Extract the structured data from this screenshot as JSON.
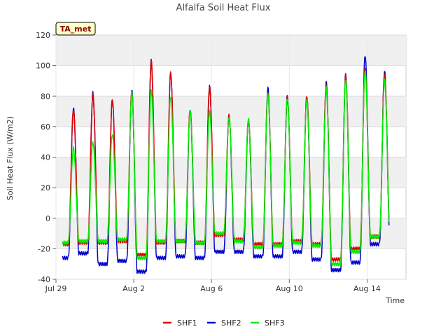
{
  "chart_data": {
    "type": "line",
    "title": "Alfalfa Soil Heat Flux",
    "xlabel": "Time",
    "ylabel": "Soil Heat Flux (W/m2)",
    "ylim": [
      -40,
      120
    ],
    "xlim": [
      "2023-07-29",
      "2023-08-16"
    ],
    "y_ticks": [
      "-40",
      "-20",
      "0",
      "20",
      "40",
      "60",
      "80",
      "100",
      "120"
    ],
    "x_ticks": [
      {
        "label": "Jul 29",
        "date": "2023-07-29"
      },
      {
        "label": "Aug 2",
        "date": "2023-08-02"
      },
      {
        "label": "Aug 6",
        "date": "2023-08-06"
      },
      {
        "label": "Aug 10",
        "date": "2023-08-10"
      },
      {
        "label": "Aug 14",
        "date": "2023-08-14"
      }
    ],
    "grid": true,
    "legend": "bottom",
    "badge": "TA_met",
    "days": [
      "2023-07-29",
      "2023-07-30",
      "2023-07-31",
      "2023-08-01",
      "2023-08-02",
      "2023-08-03",
      "2023-08-04",
      "2023-08-05",
      "2023-08-06",
      "2023-08-07",
      "2023-08-08",
      "2023-08-09",
      "2023-08-10",
      "2023-08-11",
      "2023-08-12",
      "2023-08-13",
      "2023-08-14",
      "2023-08-15"
    ],
    "series": [
      {
        "name": "SHF1",
        "color": "#dd0000",
        "daily_peak": [
          71,
          81,
          77,
          83,
          103,
          95,
          71,
          86,
          67,
          64,
          82,
          79,
          80,
          88,
          93,
          98,
          95,
          0
        ],
        "daily_min": [
          -17,
          -16,
          -16,
          -15,
          -24,
          -16,
          -15,
          -16,
          -11,
          -14,
          -17,
          -17,
          -15,
          -17,
          -27,
          -20,
          -12,
          0
        ]
      },
      {
        "name": "SHF2",
        "color": "#0000cc",
        "daily_peak": [
          72,
          82,
          78,
          84,
          103,
          95,
          71,
          86,
          67,
          64,
          85,
          80,
          80,
          89,
          94,
          107,
          96,
          0
        ],
        "daily_min": [
          -26,
          -23,
          -30,
          -28,
          -35,
          -26,
          -25,
          -26,
          -22,
          -22,
          -25,
          -25,
          -22,
          -27,
          -34,
          -29,
          -17,
          0
        ]
      },
      {
        "name": "SHF3",
        "color": "#00ee00",
        "daily_peak": [
          46,
          50,
          55,
          82,
          84,
          80,
          70,
          70,
          67,
          65,
          81,
          79,
          78,
          85,
          91,
          97,
          90,
          0
        ],
        "daily_min": [
          -16,
          -15,
          -15,
          -14,
          -26,
          -15,
          -15,
          -16,
          -10,
          -15,
          -19,
          -18,
          -16,
          -18,
          -30,
          -22,
          -12,
          0
        ]
      }
    ]
  }
}
